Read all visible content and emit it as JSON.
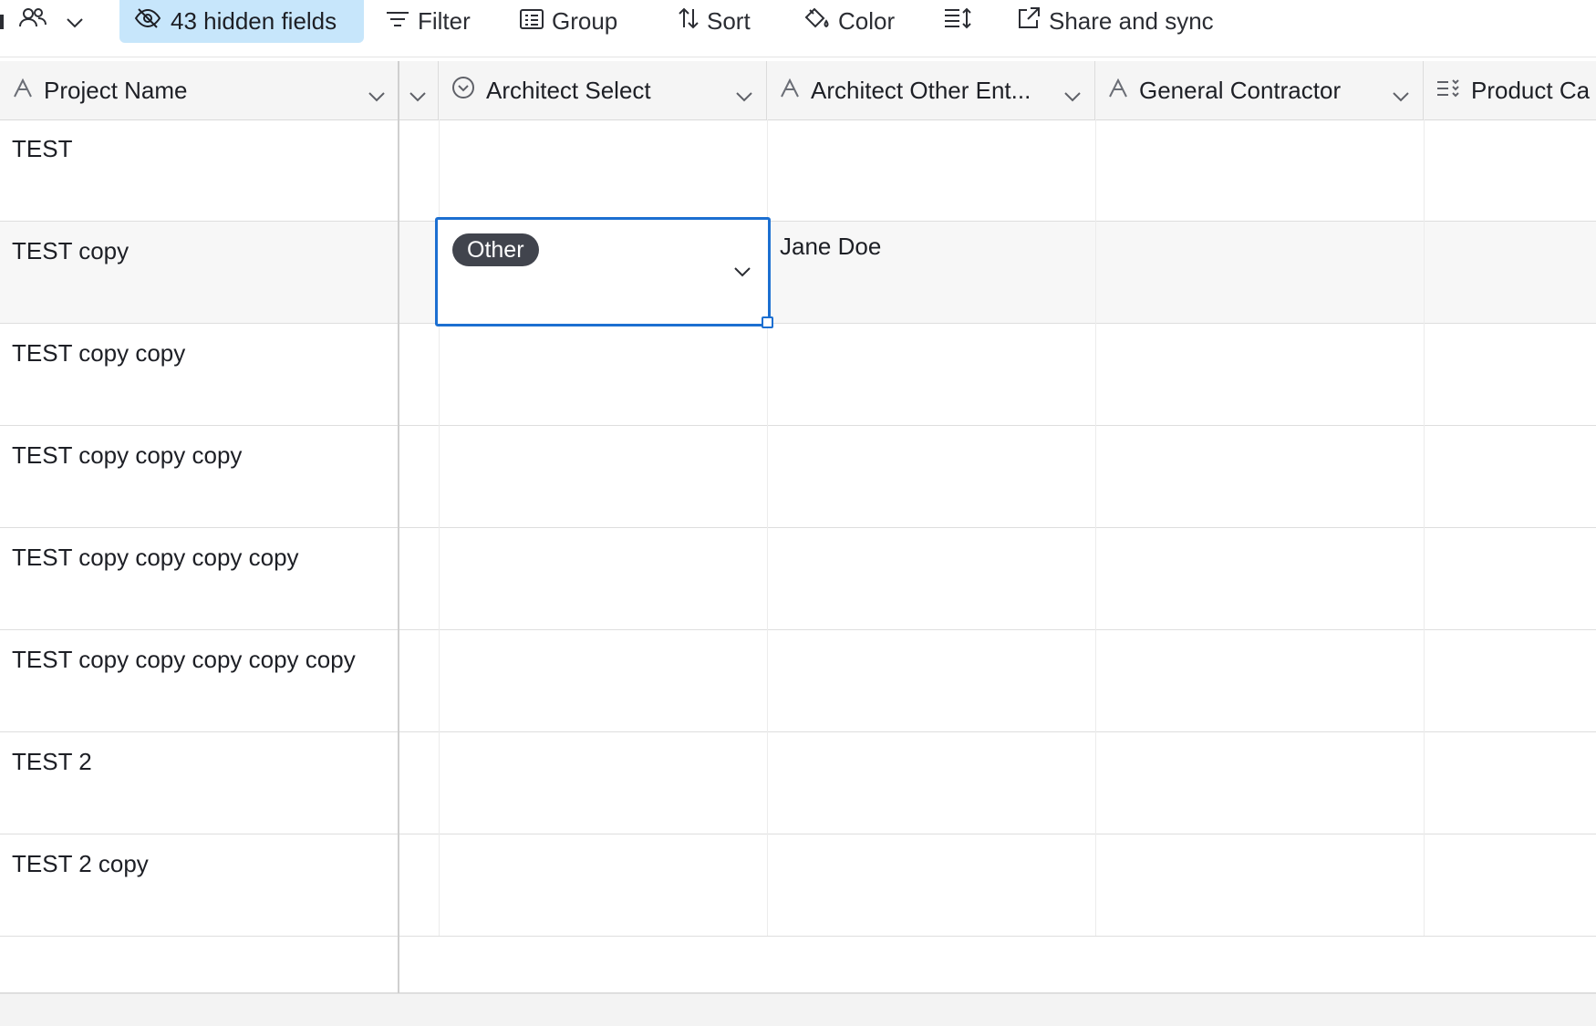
{
  "toolbar": {
    "hidden_fields_label": "43 hidden fields",
    "filter_label": "Filter",
    "group_label": "Group",
    "sort_label": "Sort",
    "color_label": "Color",
    "share_label": "Share and sync"
  },
  "columns": [
    {
      "name": "Project Name",
      "icon": "text-field-icon"
    },
    {
      "name": "Architect Select",
      "icon": "single-select-icon"
    },
    {
      "name": "Architect Other Ent...",
      "icon": "text-field-icon"
    },
    {
      "name": "General Contractor",
      "icon": "text-field-icon"
    },
    {
      "name": "Product Ca",
      "icon": "multi-select-icon"
    }
  ],
  "rows": [
    {
      "project_name": "TEST"
    },
    {
      "project_name": "TEST copy",
      "architect_select": "Other",
      "architect_other": "Jane Doe"
    },
    {
      "project_name": "TEST copy copy"
    },
    {
      "project_name": "TEST copy copy copy"
    },
    {
      "project_name": "TEST copy copy copy copy"
    },
    {
      "project_name": "TEST copy copy copy copy copy"
    },
    {
      "project_name": "TEST 2"
    },
    {
      "project_name": "TEST 2 copy"
    }
  ],
  "colors": {
    "selection_border": "#1c6fd1",
    "hidden_fields_bg": "#c7e6fb",
    "pill_bg": "#41444d"
  }
}
